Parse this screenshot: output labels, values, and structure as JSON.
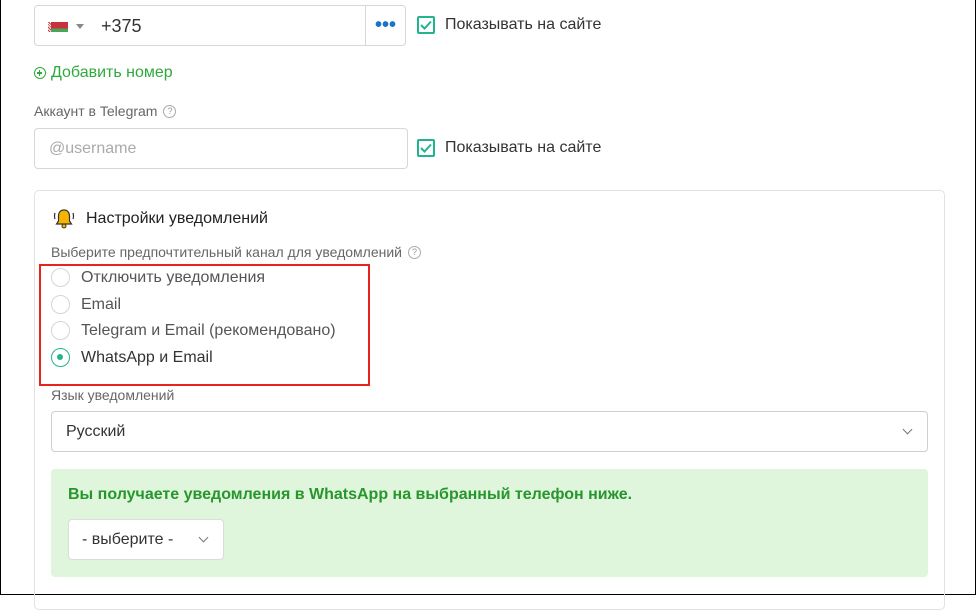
{
  "phone": {
    "country_flag": "belarus-flag",
    "value": "+375",
    "more_icon": "ellipsis-icon",
    "show_on_site_label": "Показывать на сайте",
    "show_on_site_checked": true
  },
  "add_number_label": "Добавить номер",
  "telegram": {
    "label": "Аккаунт в Telegram",
    "help_icon": "question-icon",
    "placeholder": "@username",
    "value": "",
    "show_on_site_label": "Показывать на сайте",
    "show_on_site_checked": true
  },
  "notifications": {
    "title": "Настройки уведомлений",
    "title_icon": "bell-icon",
    "channel_label": "Выберите предпочтительный канал для уведомлений",
    "options": [
      {
        "label": "Отключить уведомления",
        "selected": false
      },
      {
        "label": "Email",
        "selected": false
      },
      {
        "label": "Telegram и Email (рекомендовано)",
        "selected": false
      },
      {
        "label": "WhatsApp и Email",
        "selected": true
      }
    ],
    "language_label": "Язык уведомлений",
    "language_value": "Русский",
    "info_text": "Вы получаете уведомления в WhatsApp на выбранный телефон ниже.",
    "phone_select_value": "- выберите -"
  },
  "colors": {
    "accent": "#22b58c",
    "link_green": "#2eaa3a",
    "info_bg": "#dff5dc",
    "highlight_red": "#e8231f"
  }
}
